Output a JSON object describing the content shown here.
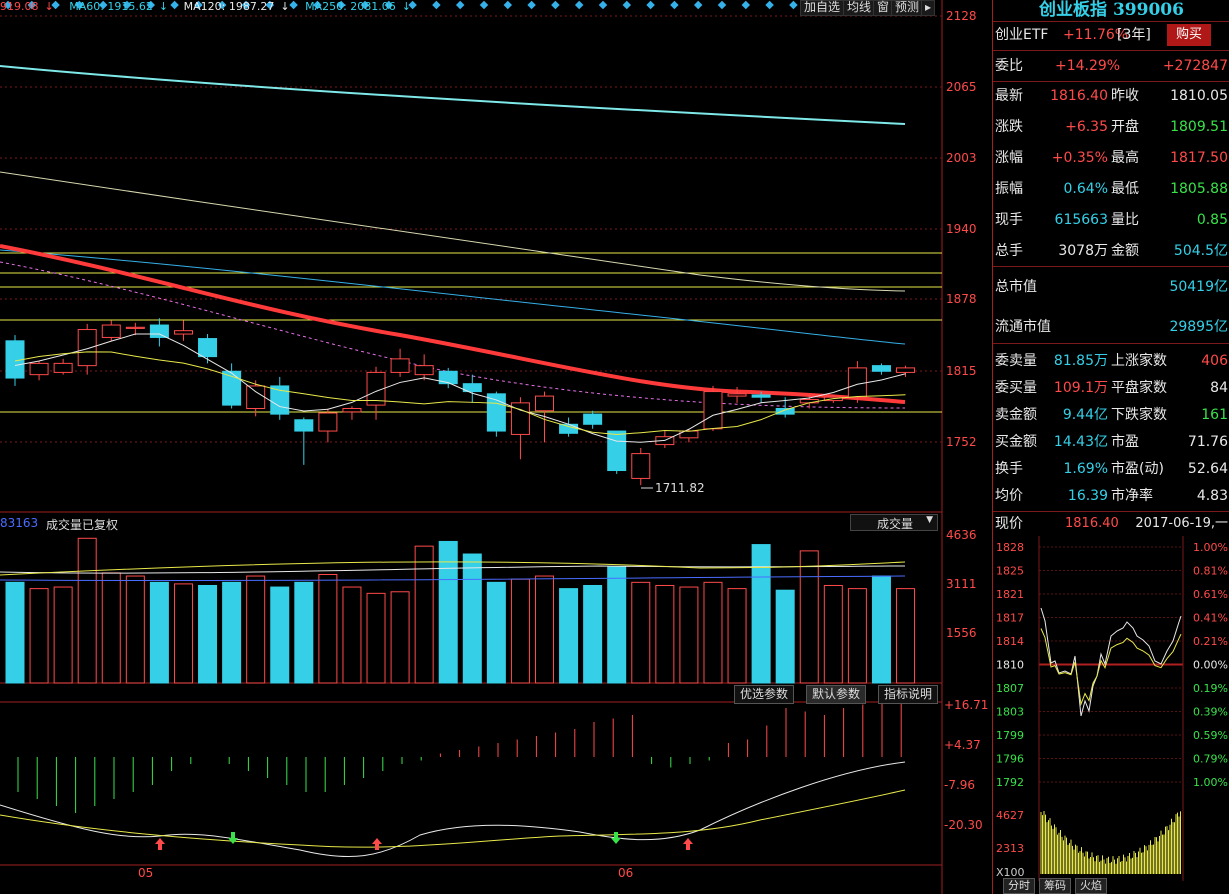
{
  "ma_legend": [
    {
      "text": "919.08",
      "arrow": "↓",
      "color": "#ff4a4a"
    },
    {
      "text": "MA60: 1915.62",
      "arrow": "↓",
      "color": "#35d0e8"
    },
    {
      "text": "MA120: 1987.27",
      "arrow": "↓",
      "color": "#e8e8e8"
    },
    {
      "text": "MA250: 2081.06",
      "arrow": "↓",
      "color": "#35d0e8"
    }
  ],
  "toolbar": {
    "add_watch": "加自选",
    "ma": "均线",
    "window": "窗",
    "forecast": "预测",
    "expand": "▸"
  },
  "price_axis": [
    "2128",
    "2065",
    "2003",
    "1940",
    "1878",
    "1815",
    "1752"
  ],
  "low_annotation": "1711.82",
  "volume_header": {
    "value": "83163",
    "label": "成交量已复权",
    "dropdown": "成交量"
  },
  "volume_axis": [
    "4636",
    "3111",
    "1556"
  ],
  "indicator_tabs": [
    "优选参数",
    "默认参数",
    "指标说明"
  ],
  "indicator_axis": [
    "+16.71",
    "+4.37",
    "-7.96",
    "-20.30"
  ],
  "date_labels": [
    "05",
    "06"
  ],
  "colors": {
    "up": "#ff4a4a",
    "down": "#35d0e8",
    "ma5": "#e8e8e8",
    "ma10": "#e8e84a",
    "ma20": "#ff3a3a",
    "grid": "#a02020"
  },
  "panel": {
    "title": "创业板指 399006",
    "etf": {
      "label": "创业ETF",
      "change": "+11.76%",
      "period": "[3年]",
      "buy": "购买"
    },
    "wei_bi": {
      "label": "委比",
      "pct": "+14.29%",
      "value": "+272847"
    },
    "quotes": [
      {
        "l1": "最新",
        "v1": "1816.40",
        "c1": "red",
        "l2": "昨收",
        "v2": "1810.05",
        "c2": "white"
      },
      {
        "l1": "涨跌",
        "v1": "+6.35",
        "c1": "red",
        "l2": "开盘",
        "v2": "1809.51",
        "c2": "green"
      },
      {
        "l1": "涨幅",
        "v1": "+0.35%",
        "c1": "red",
        "l2": "最高",
        "v2": "1817.50",
        "c2": "red"
      },
      {
        "l1": "振幅",
        "v1": "0.64%",
        "c1": "cyan",
        "l2": "最低",
        "v2": "1805.88",
        "c2": "green"
      },
      {
        "l1": "现手",
        "v1": "615663",
        "c1": "cyan",
        "l2": "量比",
        "v2": "0.85",
        "c2": "green"
      },
      {
        "l1": "总手",
        "v1": "3078万",
        "c1": "white",
        "l2": "金额",
        "v2": "504.5亿",
        "c2": "cyan"
      }
    ],
    "market_cap": [
      {
        "label": "总市值",
        "value": "50419亿"
      },
      {
        "label": "流通市值",
        "value": "29895亿"
      }
    ],
    "stats": [
      {
        "l1": "委卖量",
        "v1": "81.85万",
        "c1": "cyan",
        "l2": "上涨家数",
        "v2": "406",
        "c2": "red"
      },
      {
        "l1": "委买量",
        "v1": "109.1万",
        "c1": "red",
        "l2": "平盘家数",
        "v2": "84",
        "c2": "white"
      },
      {
        "l1": "卖金额",
        "v1": "9.44亿",
        "c1": "cyan",
        "l2": "下跌家数",
        "v2": "161",
        "c2": "green"
      },
      {
        "l1": "买金额",
        "v1": "14.43亿",
        "c1": "cyan",
        "l2": "市盈",
        "v2": "71.76",
        "c2": "white"
      },
      {
        "l1": "换手",
        "v1": "1.69%",
        "c1": "cyan",
        "l2": "市盈(动)",
        "v2": "52.64",
        "c2": "white"
      },
      {
        "l1": "均价",
        "v1": "16.39",
        "c1": "cyan",
        "l2": "市净率",
        "v2": "4.83",
        "c2": "white"
      }
    ],
    "mini_header": {
      "label": "现价",
      "price": "1816.40",
      "date": "2017-06-19,一"
    },
    "mini_left": [
      "1828",
      "1825",
      "1821",
      "1817",
      "1814",
      "1810",
      "1807",
      "1803",
      "1799",
      "1796",
      "1792"
    ],
    "mini_right": [
      "1.00%",
      "0.81%",
      "0.61%",
      "0.41%",
      "0.21%",
      "0.00%",
      "0.19%",
      "0.39%",
      "0.59%",
      "0.79%",
      "1.00%"
    ],
    "mini_vol": [
      "4627",
      "2313",
      "X100"
    ],
    "bottom_tabs": [
      "分时",
      "筹码",
      "火焰"
    ]
  },
  "chart_data": {
    "type": "candlestick",
    "y_range": [
      1690,
      2128
    ],
    "candles": [
      {
        "o": 1840,
        "h": 1845,
        "c": 1807,
        "l": 1800
      },
      {
        "o": 1810,
        "h": 1822,
        "c": 1820,
        "l": 1805
      },
      {
        "o": 1812,
        "h": 1824,
        "c": 1820,
        "l": 1810
      },
      {
        "o": 1818,
        "h": 1855,
        "c": 1850,
        "l": 1810
      },
      {
        "o": 1843,
        "h": 1858,
        "c": 1854,
        "l": 1840
      },
      {
        "o": 1851,
        "h": 1856,
        "c": 1852,
        "l": 1845
      },
      {
        "o": 1854,
        "h": 1860,
        "c": 1843,
        "l": 1835
      },
      {
        "o": 1846,
        "h": 1858,
        "c": 1849,
        "l": 1840
      },
      {
        "o": 1842,
        "h": 1846,
        "c": 1826,
        "l": 1820
      },
      {
        "o": 1813,
        "h": 1820,
        "c": 1783,
        "l": 1780
      },
      {
        "o": 1780,
        "h": 1805,
        "c": 1800,
        "l": 1773
      },
      {
        "o": 1800,
        "h": 1808,
        "c": 1775,
        "l": 1770
      },
      {
        "o": 1770,
        "h": 1772,
        "c": 1760,
        "l": 1730
      },
      {
        "o": 1760,
        "h": 1780,
        "c": 1776,
        "l": 1750
      },
      {
        "o": 1777,
        "h": 1782,
        "c": 1780,
        "l": 1770
      },
      {
        "o": 1783,
        "h": 1817,
        "c": 1812,
        "l": 1770
      },
      {
        "o": 1812,
        "h": 1833,
        "c": 1824,
        "l": 1808
      },
      {
        "o": 1810,
        "h": 1828,
        "c": 1818,
        "l": 1805
      },
      {
        "o": 1813,
        "h": 1816,
        "c": 1802,
        "l": 1798
      },
      {
        "o": 1802,
        "h": 1810,
        "c": 1795,
        "l": 1785
      },
      {
        "o": 1793,
        "h": 1795,
        "c": 1760,
        "l": 1755
      },
      {
        "o": 1757,
        "h": 1790,
        "c": 1785,
        "l": 1735
      },
      {
        "o": 1778,
        "h": 1795,
        "c": 1791,
        "l": 1750
      },
      {
        "o": 1766,
        "h": 1772,
        "c": 1758,
        "l": 1755
      },
      {
        "o": 1775,
        "h": 1778,
        "c": 1766,
        "l": 1762
      },
      {
        "o": 1760,
        "h": 1760,
        "c": 1725,
        "l": 1722
      },
      {
        "o": 1718,
        "h": 1745,
        "c": 1740,
        "l": 1712
      },
      {
        "o": 1748,
        "h": 1760,
        "c": 1755,
        "l": 1745
      },
      {
        "o": 1754,
        "h": 1762,
        "c": 1760,
        "l": 1750
      },
      {
        "o": 1762,
        "h": 1800,
        "c": 1795,
        "l": 1760
      },
      {
        "o": 1791,
        "h": 1799,
        "c": 1793,
        "l": 1785
      },
      {
        "o": 1792,
        "h": 1795,
        "c": 1790,
        "l": 1785
      },
      {
        "o": 1780,
        "h": 1790,
        "c": 1775,
        "l": 1772
      },
      {
        "o": 1785,
        "h": 1792,
        "c": 1788,
        "l": 1780
      },
      {
        "o": 1787,
        "h": 1792,
        "c": 1790,
        "l": 1785
      },
      {
        "o": 1790,
        "h": 1822,
        "c": 1816,
        "l": 1785
      },
      {
        "o": 1818,
        "h": 1820,
        "c": 1813,
        "l": 1810
      },
      {
        "o": 1812,
        "h": 1818,
        "c": 1816,
        "l": 1808
      }
    ],
    "volume": [
      3200,
      3000,
      3050,
      4600,
      3500,
      3400,
      3200,
      3150,
      3100,
      3200,
      3400,
      3050,
      3200,
      3450,
      3050,
      2850,
      2900,
      4350,
      4500,
      4100,
      3200,
      3300,
      3400,
      3000,
      3100,
      3700,
      3200,
      3100,
      3050,
      3200,
      3000,
      4400,
      2950,
      4200,
      3100,
      3000,
      3400,
      3000
    ],
    "macd": [
      -10,
      -12,
      -14,
      -16,
      -14,
      -12,
      -10,
      -8,
      -4,
      -2,
      0,
      -2,
      -4,
      -6,
      -8,
      -10,
      -10,
      -8,
      -6,
      -4,
      -2,
      -1,
      1,
      2,
      3,
      4,
      5,
      6,
      7,
      8,
      10,
      11,
      12,
      -2,
      -3,
      -2,
      -1,
      4,
      5,
      9,
      14,
      13,
      12,
      14,
      15,
      16,
      17
    ],
    "ma60": [
      2110,
      2100,
      2090,
      2080,
      2070,
      2060,
      2050,
      2045,
      2040,
      2035
    ],
    "ma120": [
      1980,
      1965,
      1950,
      1935,
      1920,
      1910,
      1900,
      1895,
      1890,
      1888
    ]
  }
}
